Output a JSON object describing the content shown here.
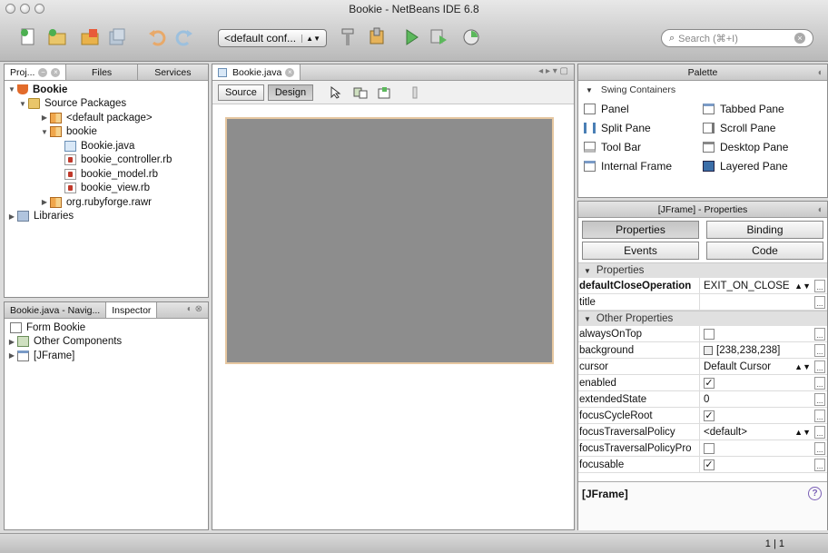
{
  "window": {
    "title": "Bookie - NetBeans IDE 6.8"
  },
  "toolbar": {
    "config_value": "<default conf...",
    "search_placeholder": "Search (⌘+I)",
    "icons": [
      "new-file-icon",
      "new-project-icon",
      "open-project-icon",
      "save-all-icon",
      "undo-icon",
      "redo-icon",
      "clean-build-icon",
      "build-icon",
      "run-icon",
      "debug-icon",
      "profile-icon"
    ]
  },
  "projects_panel": {
    "tabs": [
      {
        "label": "Proj..."
      },
      {
        "label": "Files"
      },
      {
        "label": "Services"
      }
    ],
    "tree": [
      {
        "label": "Bookie"
      },
      {
        "label": "Source Packages"
      },
      {
        "label": "<default package>"
      },
      {
        "label": "bookie"
      },
      {
        "label": "Bookie.java"
      },
      {
        "label": "bookie_controller.rb"
      },
      {
        "label": "bookie_model.rb"
      },
      {
        "label": "bookie_view.rb"
      },
      {
        "label": "org.rubyforge.rawr"
      },
      {
        "label": "Libraries"
      }
    ]
  },
  "navigator_panel": {
    "tabs": [
      {
        "label": "Bookie.java - Navig..."
      },
      {
        "label": "Inspector"
      }
    ],
    "tree": [
      {
        "label": "Form Bookie"
      },
      {
        "label": "Other Components"
      },
      {
        "label": "[JFrame]"
      }
    ]
  },
  "editor": {
    "tab_label": "Bookie.java",
    "source_label": "Source",
    "design_label": "Design"
  },
  "palette": {
    "title": "Palette",
    "category": "Swing Containers",
    "items": [
      {
        "label": "Panel"
      },
      {
        "label": "Tabbed Pane"
      },
      {
        "label": "Split Pane"
      },
      {
        "label": "Scroll Pane"
      },
      {
        "label": "Tool Bar"
      },
      {
        "label": "Desktop Pane"
      },
      {
        "label": "Internal Frame"
      },
      {
        "label": "Layered Pane"
      }
    ]
  },
  "properties": {
    "title": "[JFrame] - Properties",
    "buttons": {
      "properties": "Properties",
      "binding": "Binding",
      "events": "Events",
      "code": "Code"
    },
    "section_properties": "Properties",
    "section_other": "Other Properties",
    "rows_main": [
      {
        "name": "defaultCloseOperation",
        "value": "EXIT_ON_CLOSE"
      },
      {
        "name": "title",
        "value": ""
      }
    ],
    "rows_other": [
      {
        "name": "alwaysOnTop",
        "value": ""
      },
      {
        "name": "background",
        "value": "[238,238,238]"
      },
      {
        "name": "cursor",
        "value": "Default Cursor"
      },
      {
        "name": "enabled",
        "value": "✓"
      },
      {
        "name": "extendedState",
        "value": "0"
      },
      {
        "name": "focusCycleRoot",
        "value": "✓"
      },
      {
        "name": "focusTraversalPolicy",
        "value": "<default>"
      },
      {
        "name": "focusTraversalPolicyPro",
        "value": ""
      },
      {
        "name": "focusable",
        "value": "✓"
      }
    ],
    "footer": "[JFrame]",
    "help": "?"
  },
  "status": {
    "position": "1 | 1"
  }
}
